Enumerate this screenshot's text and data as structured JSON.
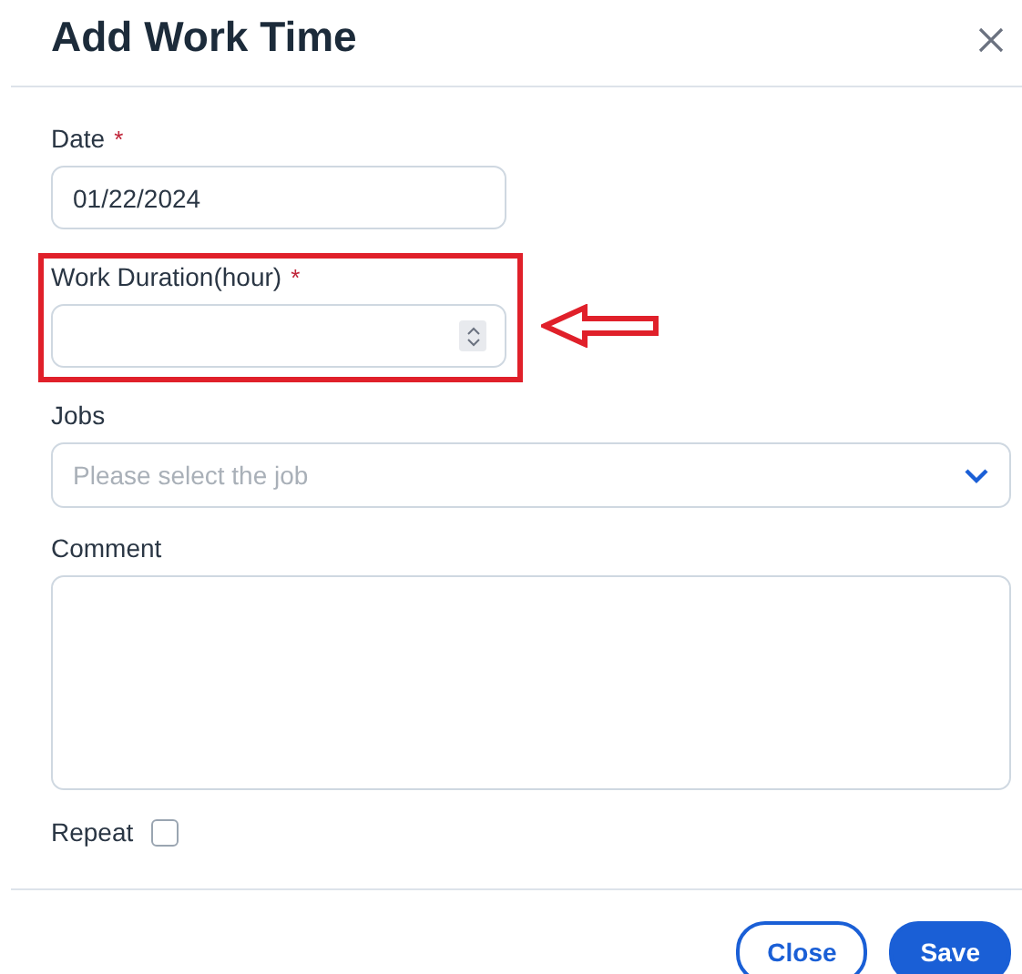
{
  "dialog": {
    "title": "Add Work Time"
  },
  "fields": [
    {
      "kind": "text",
      "label": "Date",
      "required_mark": "*",
      "value": "01/22/2024"
    },
    {
      "kind": "number",
      "label": "Work Duration(hour)",
      "required_mark": "*",
      "highlighted": true
    },
    {
      "kind": "select",
      "label": "Jobs",
      "placeholder": "Please select the job"
    },
    {
      "kind": "textarea",
      "label": "Comment"
    },
    {
      "kind": "checkbox",
      "label": "Repeat",
      "checked": false
    }
  ],
  "buttons": [
    {
      "label": "Close",
      "kind": "secondary"
    },
    {
      "label": "Save",
      "kind": "primary"
    }
  ]
}
